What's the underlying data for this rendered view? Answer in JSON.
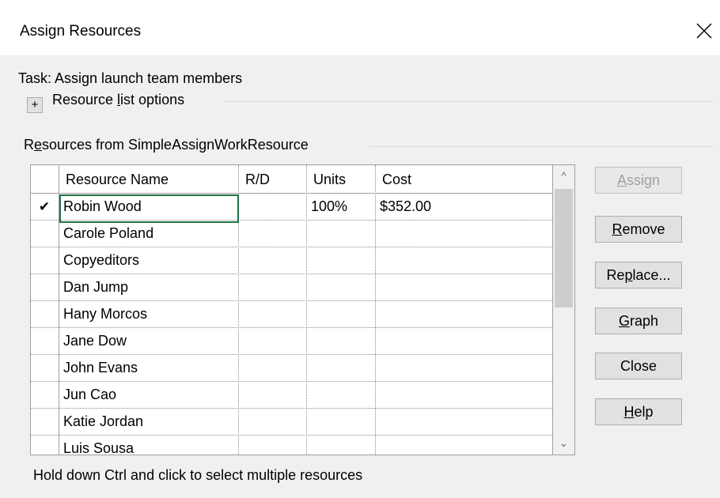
{
  "window": {
    "title": "Assign Resources",
    "close_icon": "close-icon"
  },
  "task": {
    "label": "Task: Assign launch team members"
  },
  "options": {
    "expand_symbol": "+",
    "label_pre": "Resource ",
    "label_key": "l",
    "label_post": "ist options"
  },
  "resources_from": {
    "label_pre": "R",
    "label_key": "e",
    "label_post": "sources from SimpleAssignWorkResource"
  },
  "grid": {
    "columns": [
      "",
      "Resource Name",
      "R/D",
      "Units",
      "Cost"
    ],
    "rows": [
      {
        "check": "✔",
        "name": "Robin Wood",
        "rd": "",
        "units": "100%",
        "cost": "$352.00"
      },
      {
        "check": "",
        "name": "Carole Poland",
        "rd": "",
        "units": "",
        "cost": ""
      },
      {
        "check": "",
        "name": "Copyeditors",
        "rd": "",
        "units": "",
        "cost": ""
      },
      {
        "check": "",
        "name": "Dan Jump",
        "rd": "",
        "units": "",
        "cost": ""
      },
      {
        "check": "",
        "name": "Hany Morcos",
        "rd": "",
        "units": "",
        "cost": ""
      },
      {
        "check": "",
        "name": "Jane Dow",
        "rd": "",
        "units": "",
        "cost": ""
      },
      {
        "check": "",
        "name": "John Evans",
        "rd": "",
        "units": "",
        "cost": ""
      },
      {
        "check": "",
        "name": "Jun Cao",
        "rd": "",
        "units": "",
        "cost": ""
      },
      {
        "check": "",
        "name": "Katie Jordan",
        "rd": "",
        "units": "",
        "cost": ""
      },
      {
        "check": "",
        "name": "Luis Sousa",
        "rd": "",
        "units": "",
        "cost": ""
      }
    ]
  },
  "scrollbar": {
    "up": "^",
    "down": "⌄"
  },
  "buttons": {
    "assign": {
      "key": "A",
      "rest": "ssign"
    },
    "remove": {
      "key": "R",
      "rest": "emove"
    },
    "replace": {
      "pre": "Re",
      "key": "p",
      "rest": "lace..."
    },
    "graph": {
      "key": "G",
      "rest": "raph"
    },
    "close": {
      "label": "Close"
    },
    "help": {
      "key": "H",
      "rest": "elp"
    }
  },
  "status": "Hold down Ctrl and click to select multiple resources"
}
